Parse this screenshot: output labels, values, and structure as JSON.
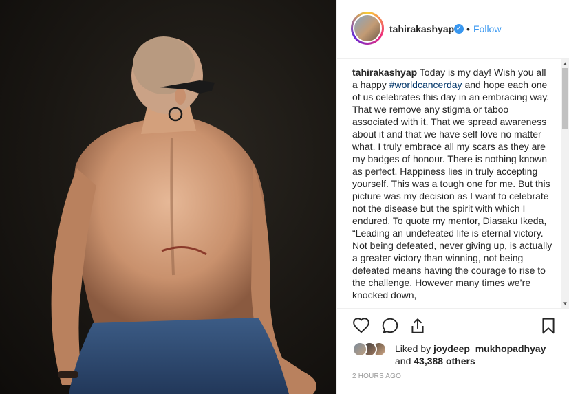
{
  "post": {
    "image_alt": "Woman with shaved head and sunglasses, back turned, showing a surgical scar"
  },
  "header": {
    "username": "tahirakashyap",
    "verified_symbol": "✓",
    "dot": "•",
    "follow_label": "Follow"
  },
  "caption": {
    "username": "tahirakashyap",
    "text_before_tag": " Today is my day! Wish you all a happy ",
    "hashtag": "#worldcancerday",
    "text_after_tag": " and hope each one of us celebrates this day in an embracing way. That we remove any stigma or taboo associated with it. That we spread awareness about it and that we have self love no matter what. I truly embrace all my scars as they are my badges of honour. There is nothing known as perfect. Happiness lies in truly accepting yourself. This was a tough one for me. But this picture was my decision as I want to celebrate not the disease but the spirit with which I endured. To quote my mentor, Diasaku Ikeda, “Leading an undefeated life is eternal victory. Not being defeated, never giving up, is actually a greater victory than winning, not being defeated means having the courage to rise to the challenge. However many times we’re knocked down,"
  },
  "scrollbar": {
    "up_symbol": "▲",
    "down_symbol": "▼"
  },
  "actions": {
    "like_icon": "heart-icon",
    "comment_icon": "comment-icon",
    "share_icon": "share-icon",
    "save_icon": "bookmark-icon"
  },
  "likes": {
    "prefix": "Liked by ",
    "liker": "joydeep_mukhopadhyay",
    "conjunction": "and ",
    "count": "43,388 others"
  },
  "timestamp": "2 HOURS AGO"
}
